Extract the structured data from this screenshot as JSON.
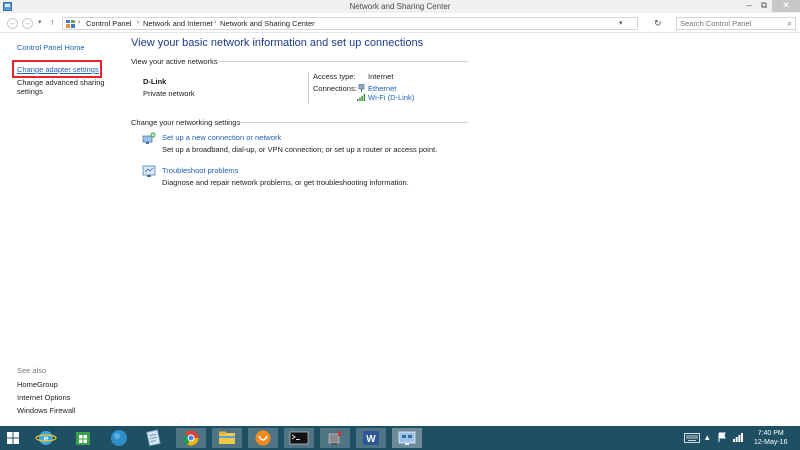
{
  "window": {
    "title": "Network and Sharing Center",
    "controls": {
      "minimize": "–",
      "restore": "⧉",
      "close": "✕"
    }
  },
  "addressbar": {
    "crumbs": [
      "Control Panel",
      "Network and Internet",
      "Network and Sharing Center"
    ],
    "search_placeholder": "Search Control Panel"
  },
  "left_panel": {
    "home": "Control Panel Home",
    "change_adapter": "Change adapter settings",
    "change_sharing_line1": "Change advanced sharing",
    "change_sharing_line2": "settings",
    "see_also": "See also",
    "see_also_links": [
      "HomeGroup",
      "Internet Options",
      "Windows Firewall"
    ]
  },
  "main": {
    "title": "View your basic network information and set up connections",
    "active_networks_label": "View your active networks",
    "network_name": "D-Link",
    "network_type": "Private network",
    "access_type_label": "Access type:",
    "access_type_value": "Internet",
    "connections_label": "Connections:",
    "connection_ethernet": "Ethernet",
    "connection_wifi": "Wi-Fi (D-Link)",
    "change_settings_label": "Change your networking settings",
    "setup_title": "Set up a new connection or network",
    "setup_desc": "Set up a broadband, dial-up, or VPN connection; or set up a router or access point.",
    "troubleshoot_title": "Troubleshoot problems",
    "troubleshoot_desc": "Diagnose and repair network problems, or get troubleshooting information."
  },
  "taskbar": {
    "time": "7:40 PM",
    "date": "12-May-16",
    "apps": [
      "start-icon",
      "internet-explorer-icon",
      "store-icon",
      "globe-icon",
      "notepad-icon",
      "chrome-icon",
      "file-explorer-icon",
      "uc-browser-icon",
      "command-prompt-icon",
      "device-icon",
      "word-icon",
      "network-control-panel-icon"
    ]
  },
  "colors": {
    "link": "#1e5fb4",
    "title_blue": "#1c3d8a",
    "highlight_red": "#e6242b",
    "taskbar": "#1e4f63"
  }
}
